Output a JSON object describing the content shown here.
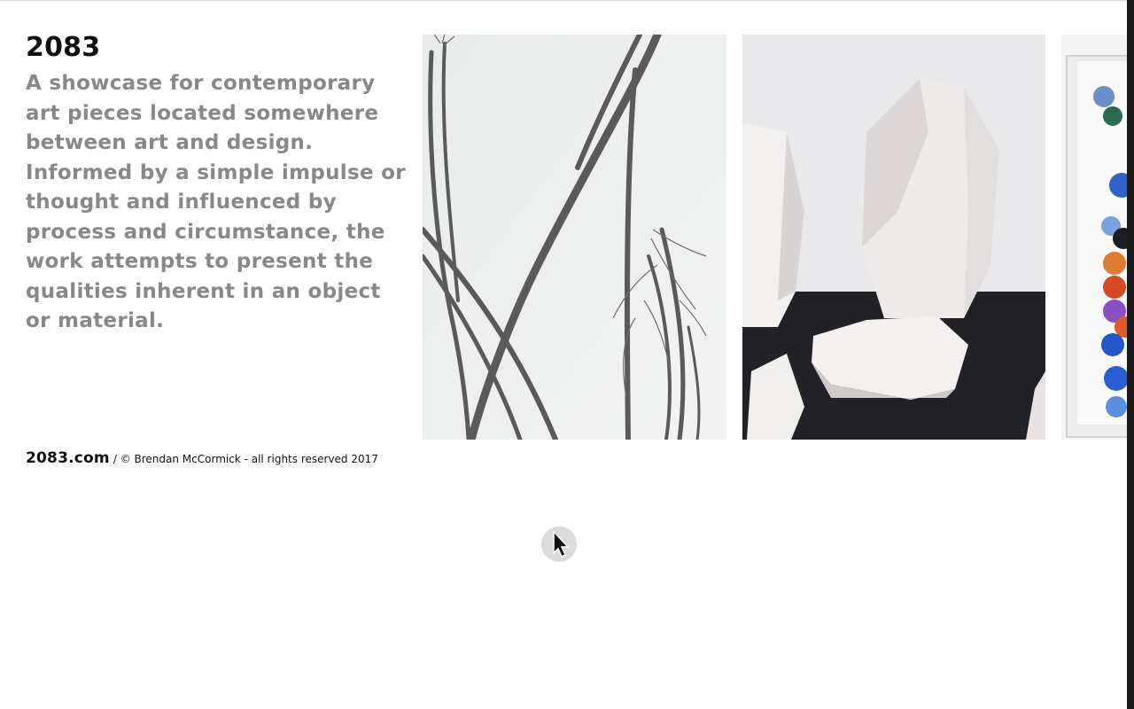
{
  "site": {
    "title": "2083",
    "description": "A showcase for contemporary art pieces located somewhere between art and design. Informed by a simple impulse or thought and influenced by process and circumstance, the work attempts to present the qualities inherent in an object or material."
  },
  "gallery": {
    "images": [
      {
        "subject": "dried branch sculpture"
      },
      {
        "subject": "white faceted stone sculptures"
      },
      {
        "subject": "framed colored discs"
      }
    ]
  },
  "footer": {
    "domain": "2083.com",
    "copyright": "/ © Brendan McCormick - all rights reserved 2017"
  },
  "colors": {
    "title": "#111111",
    "description": "#888888",
    "background": "#ffffff"
  }
}
